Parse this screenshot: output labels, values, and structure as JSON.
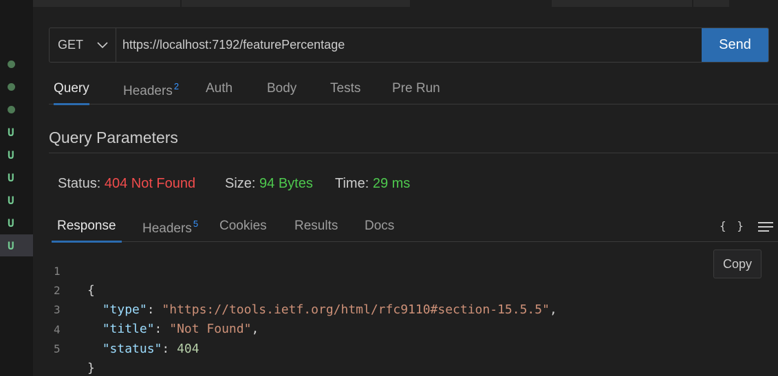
{
  "gutter": {
    "marks": [
      {
        "type": "dot"
      },
      {
        "type": "dot"
      },
      {
        "type": "dot"
      },
      {
        "type": "u",
        "label": "U"
      },
      {
        "type": "u",
        "label": "U"
      },
      {
        "type": "u",
        "label": "U"
      },
      {
        "type": "u",
        "label": "U"
      },
      {
        "type": "u",
        "label": "U"
      },
      {
        "type": "u",
        "label": "U",
        "active": true
      }
    ]
  },
  "request": {
    "method": "GET",
    "url": "https://localhost:7192/featurePercentage",
    "send_label": "Send"
  },
  "request_tabs": [
    {
      "label": "Query",
      "active": true
    },
    {
      "label": "Headers",
      "badge": "2"
    },
    {
      "label": "Auth"
    },
    {
      "label": "Body"
    },
    {
      "label": "Tests"
    },
    {
      "label": "Pre Run"
    }
  ],
  "query_section_title": "Query Parameters",
  "status": {
    "status_label": "Status:",
    "status_value": "404 Not Found",
    "size_label": "Size:",
    "size_value": "94 Bytes",
    "time_label": "Time:",
    "time_value": "29 ms"
  },
  "response_tabs": [
    {
      "label": "Response",
      "active": true
    },
    {
      "label": "Headers",
      "badge": "5"
    },
    {
      "label": "Cookies"
    },
    {
      "label": "Results"
    },
    {
      "label": "Docs"
    }
  ],
  "response_toolbar": {
    "format_label": "{ }",
    "menu_icon": "hamburger-menu-icon"
  },
  "response_body": {
    "line_numbers": [
      "1",
      "2",
      "3",
      "4",
      "5"
    ],
    "open_brace": "{",
    "close_brace": "}",
    "type_key": "\"type\"",
    "type_value": "\"https://tools.ietf.org/html/rfc9110#section-15.5.5\"",
    "title_key": "\"title\"",
    "title_value": "\"Not Found\"",
    "status_key": "\"status\"",
    "status_value": "404"
  },
  "copy_label": "Copy",
  "colors": {
    "accent": "#2b6cb0",
    "error": "#f14c4c",
    "success": "#4ec94e",
    "badge": "#3794ff"
  }
}
